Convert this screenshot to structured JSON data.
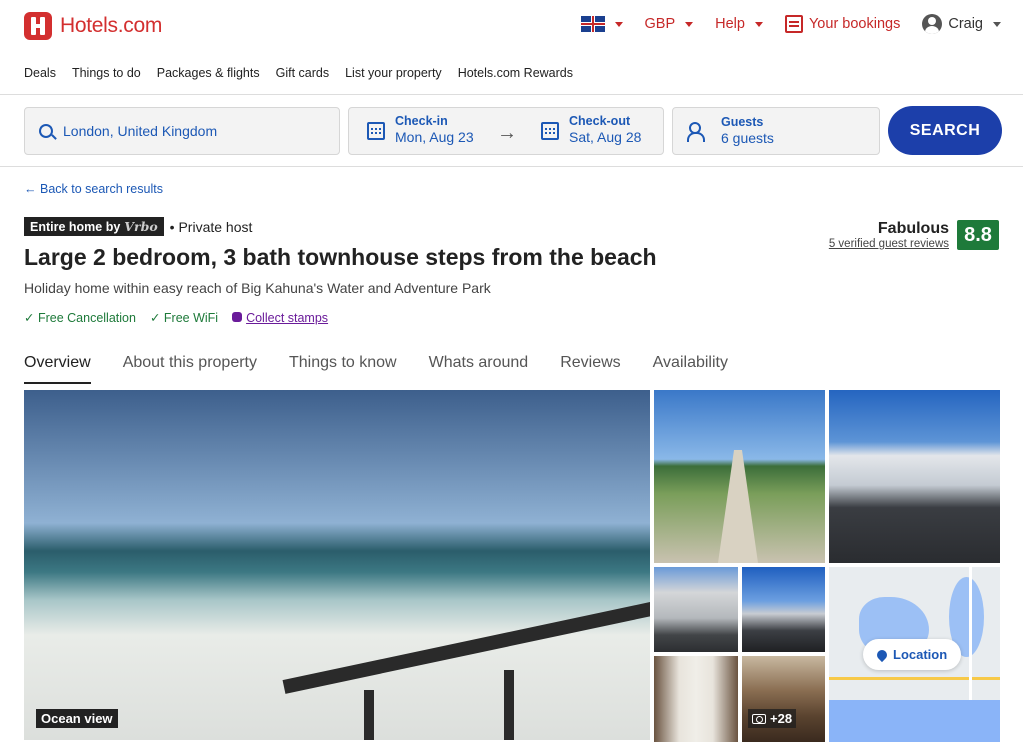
{
  "brand": {
    "name": "Hotels.com",
    "color": "#d32f2f"
  },
  "topnav": {
    "currency": "GBP",
    "help": "Help",
    "bookings": "Your bookings",
    "user": "Craig"
  },
  "subnav": [
    "Deals",
    "Things to do",
    "Packages & flights",
    "Gift cards",
    "List your property",
    "Hotels.com Rewards"
  ],
  "search": {
    "destination": "London, United Kingdom",
    "checkin_label": "Check-in",
    "checkin_value": "Mon, Aug 23",
    "checkout_label": "Check-out",
    "checkout_value": "Sat, Aug 28",
    "guests_label": "Guests",
    "guests_value": "6 guests",
    "button": "SEARCH"
  },
  "back_link": "Back to search results",
  "property": {
    "badge_prefix": "Entire home by",
    "badge_brand": "Vrbo",
    "host": "• Private host",
    "title": "Large 2 bedroom, 3 bath townhouse steps from the beach",
    "subtitle": "Holiday home within easy reach of Big Kahuna's Water and Adventure Park",
    "amenities": [
      "Free Cancellation",
      "Free WiFi"
    ],
    "stamps": "Collect stamps",
    "rating_word": "Fabulous",
    "reviews": "5 verified guest reviews",
    "score": "8.8"
  },
  "tabs": [
    "Overview",
    "About this property",
    "Things to know",
    "Whats around",
    "Reviews",
    "Availability"
  ],
  "gallery": {
    "main_caption": "Ocean view",
    "more_count": "+28",
    "location_label": "Location"
  }
}
